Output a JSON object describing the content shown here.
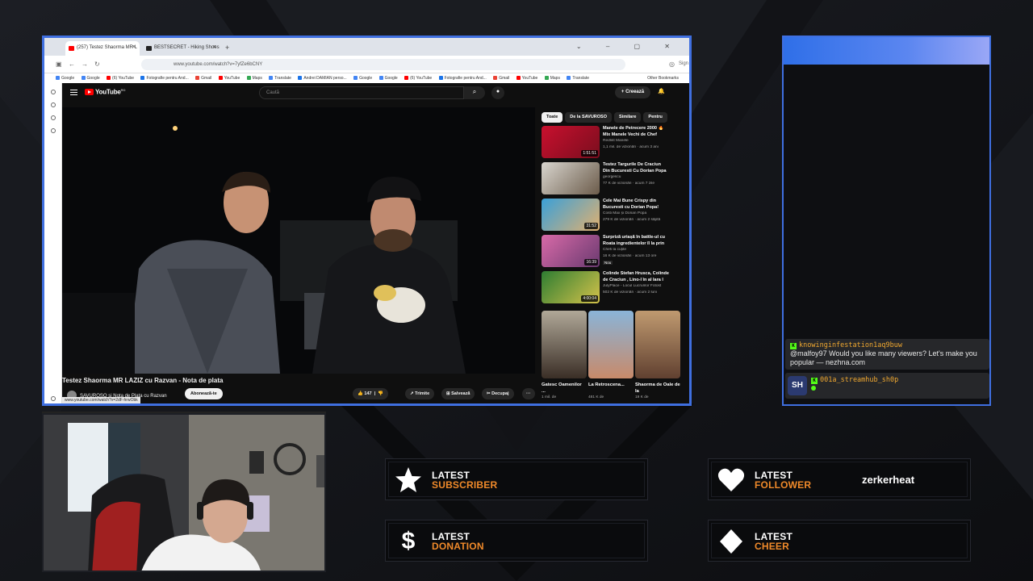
{
  "browser": {
    "tabs": [
      "(257) Testez Shaorma MR L",
      "BESTSECRET - Hiking Shoes"
    ],
    "url": "www.youtube.com/watch?v=7yfZe6bCNY",
    "sign_in": "Sign",
    "bookmarks": [
      "Google",
      "Google",
      "(6) YouTube",
      "Fotografie pentru And...",
      "Gmail",
      "YouTube",
      "Maps",
      "Translate",
      "Andrei DAMIAN perso...",
      "Google",
      "Google",
      "(6) YouTube",
      "Fotografie pentru And...",
      "Gmail",
      "YouTube",
      "Maps",
      "Translate"
    ],
    "other_bookmarks": "Other Bookmarks"
  },
  "youtube": {
    "logo": "YouTube",
    "region": "RO",
    "search_placeholder": "Caută",
    "create": "Creează",
    "chips": [
      "Toate",
      "De la SAVUROSO",
      "Similare",
      "Pentru"
    ],
    "video": {
      "title": "Testez Shaorma MR LAZIZ cu Razvan - Nota de plata",
      "channel": "SAVUROSO și Nota de Plata cu Razvan",
      "subscribe": "Abonează-te",
      "likes": "147",
      "share": "Trimite",
      "save": "Salvează",
      "clip": "Decupaj"
    },
    "status_url": "www.youtube.com/watch?v=2dF-hrwObk",
    "recs": [
      {
        "title": "Manele de Petrecere 2000 🔥 Mix Manele Vechi de Chef",
        "channel": "Redlist Manele",
        "meta": "1,1 mil. de vizionări · acum 3 ani",
        "duration": "1:51:51"
      },
      {
        "title": "Testez Targurile De Craciun Din Bucuresti Cu Dorian Popa",
        "channel": "georgescu",
        "meta": "77 K de vizionări · acum 7 zile"
      },
      {
        "title": "Cele Mai Bune Crispy din Bucuresti cu Dorian Popa!",
        "channel": "Costi Max și Dorian Popa",
        "meta": "279 K de vizionări · acum 2 săptă",
        "duration": "31:52"
      },
      {
        "title": "Surpriză uriașă în battle-ul cu Roata ingredientelor îl la prin",
        "channel": "Chefi la cuțite",
        "meta": "16 K de vizionări · acum 13 ore",
        "duration": "16:39",
        "badge": "Nou"
      },
      {
        "title": "Colinde Stefan Hrusca, Colinde de Craciun , Lino-l în al lara l",
        "channel": "JulyPlace - Locul Lucrurilor Fotost",
        "meta": "502 K de vizionări · acum 2 luni",
        "duration": "4:00:04"
      }
    ],
    "shorts": [
      {
        "title": "Gatesc Oamenilor ...",
        "views": "1 mil. de"
      },
      {
        "title": "La Retroscena...",
        "views": "481 K de"
      },
      {
        "title": "Shaorma de Oale de la",
        "views": "19 K de"
      }
    ]
  },
  "chat": {
    "messages": [
      {
        "user": "knowinginfestation1aq9buw",
        "text": "@malfoy97 Would you like many viewers? Let's make you popular — nezhna.com"
      },
      {
        "user": "001a_streamhub_sh0p",
        "avatar_text": "SH"
      }
    ]
  },
  "alerts": [
    {
      "line1": "LATEST",
      "line2": "SUBSCRIBER",
      "value": ""
    },
    {
      "line1": "LATEST",
      "line2": "FOLLOWER",
      "value": "zerkerheat"
    },
    {
      "line1": "LATEST",
      "line2": "DONATION",
      "value": ""
    },
    {
      "line1": "LATEST",
      "line2": "CHEER",
      "value": ""
    }
  ],
  "colors": {
    "accent_blue": "#3f6fe0",
    "alert_orange": "#f08a2a",
    "kick_green": "#53fc18",
    "youtube_red": "#ff0000"
  }
}
